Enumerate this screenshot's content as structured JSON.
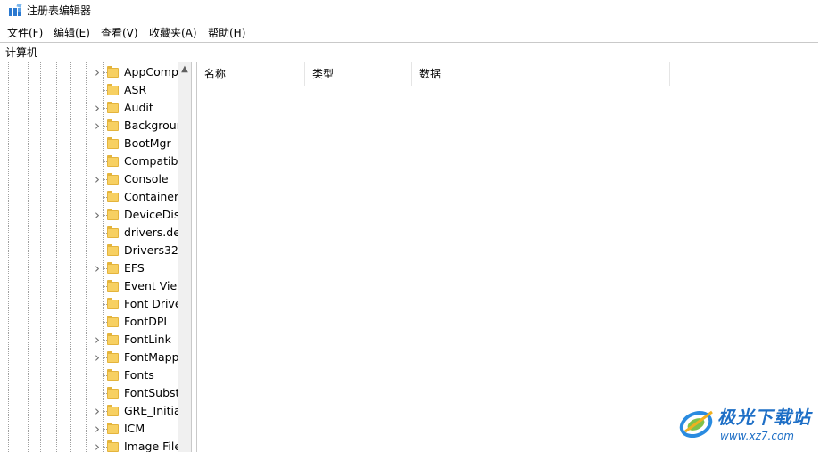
{
  "window": {
    "title": "注册表编辑器",
    "icon": "regedit-icon"
  },
  "menu": [
    "文件(F)",
    "编辑(E)",
    "查看(V)",
    "收藏夹(A)",
    "帮助(H)"
  ],
  "address": "计算机",
  "tree": {
    "items": [
      {
        "label": "AppComp",
        "expandable": true
      },
      {
        "label": "ASR",
        "expandable": false
      },
      {
        "label": "Audit",
        "expandable": true
      },
      {
        "label": "Backgrour",
        "expandable": true
      },
      {
        "label": "BootMgr",
        "expandable": false
      },
      {
        "label": "Compatibi",
        "expandable": false
      },
      {
        "label": "Console",
        "expandable": true
      },
      {
        "label": "Containers",
        "expandable": false
      },
      {
        "label": "DeviceDisp",
        "expandable": true
      },
      {
        "label": "drivers.de",
        "expandable": false
      },
      {
        "label": "Drivers32",
        "expandable": false
      },
      {
        "label": "EFS",
        "expandable": true
      },
      {
        "label": "Event View",
        "expandable": false
      },
      {
        "label": "Font Drive",
        "expandable": false
      },
      {
        "label": "FontDPI",
        "expandable": false
      },
      {
        "label": "FontLink",
        "expandable": true
      },
      {
        "label": "FontMapp",
        "expandable": true
      },
      {
        "label": "Fonts",
        "expandable": false
      },
      {
        "label": "FontSubsti",
        "expandable": false
      },
      {
        "label": "GRE_Initial",
        "expandable": true
      },
      {
        "label": "ICM",
        "expandable": true
      },
      {
        "label": "Image File",
        "expandable": true
      }
    ]
  },
  "list": {
    "columns": [
      "名称",
      "类型",
      "数据"
    ]
  },
  "watermark": {
    "title": "极光下载站",
    "url": "www.xz7.com",
    "color": "#1e6fc6"
  }
}
